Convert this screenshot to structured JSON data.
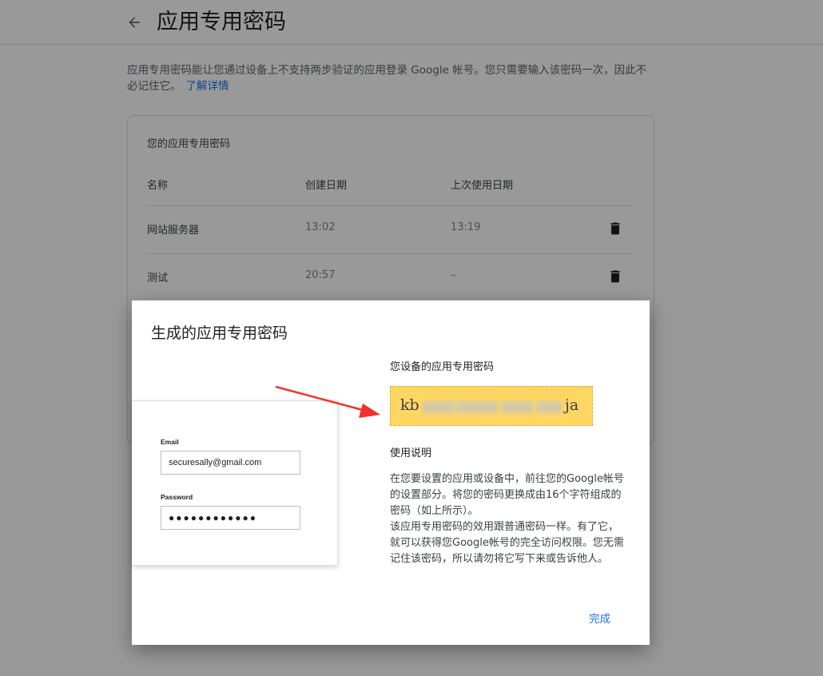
{
  "header": {
    "title": "应用专用密码"
  },
  "intro": {
    "text": "应用专用密码能让您通过设备上不支持两步验证的应用登录 Google 帐号。您只需要输入该密码一次，因此不必记住它。",
    "link": "了解详情"
  },
  "card": {
    "title": "您的应用专用密码",
    "columns": [
      "名称",
      "创建日期",
      "上次使用日期"
    ],
    "rows": [
      {
        "name": "网站服务器",
        "created": "13:02",
        "last_used": "13:19"
      },
      {
        "name": "测试",
        "created": "20:57",
        "last_used": "–"
      }
    ]
  },
  "dialog": {
    "title": "生成的应用专用密码",
    "illustration": {
      "email_label": "Email",
      "email_value": "securesally@gmail.com",
      "password_label": "Password",
      "password_value": "●●●●●●●●●●●●"
    },
    "password_label": "您设备的应用专用密码",
    "password_start": "kb",
    "password_end": "ja",
    "usage_title": "使用说明",
    "usage_p1": "在您要设置的应用或设备中，前往您的Google帐号的设置部分。将您的密码更换成由16个字符组成的密码（如上所示）。",
    "usage_p2": "该应用专用密码的效用跟普通密码一样。有了它，就可以获得您Google帐号的完全访问权限。您无需记住该密码，所以请勿将它写下来或告诉他人。",
    "done": "完成"
  },
  "colors": {
    "accent": "#1a73e8",
    "highlight": "#fdd663",
    "arrow": "#f0302a"
  },
  "icons": {
    "back": "arrow-left-icon",
    "delete": "trash-icon"
  }
}
